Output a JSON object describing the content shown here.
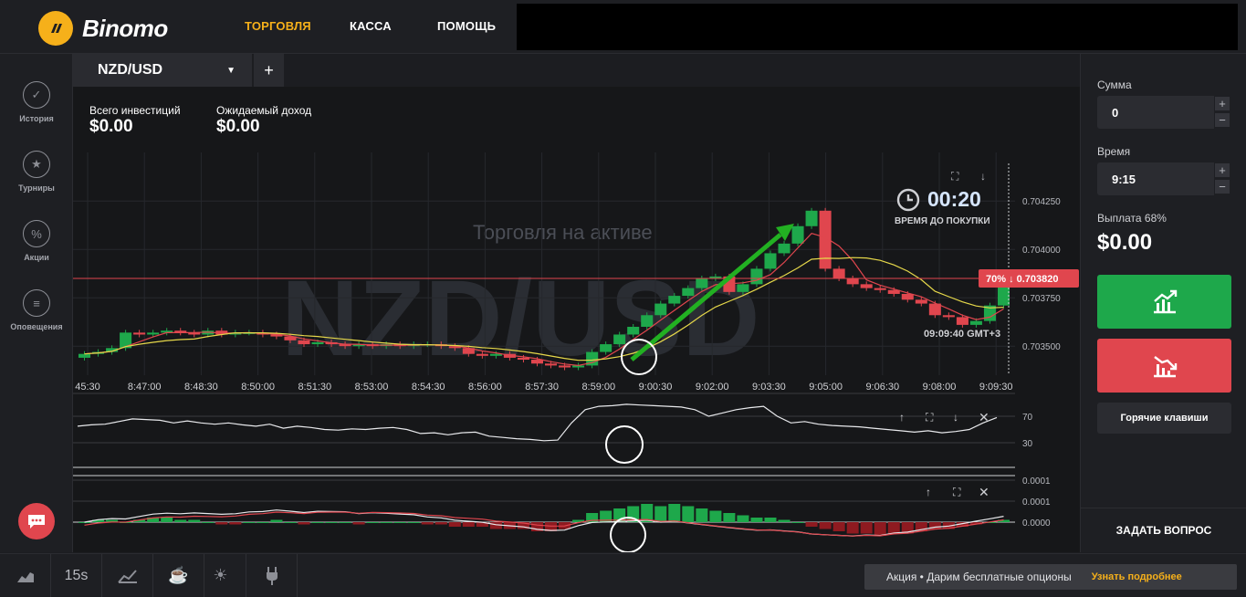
{
  "brand": {
    "name": "Binomo",
    "accent": "#f6b01a"
  },
  "nav": {
    "trade": "ТОРГОВЛЯ",
    "cashier": "КАССА",
    "help": "ПОМОЩЬ"
  },
  "sidebar": {
    "items": [
      {
        "label": "История",
        "icon": "check-circle-icon"
      },
      {
        "label": "Турниры",
        "icon": "trophy-icon"
      },
      {
        "label": "Акции",
        "icon": "percent-icon"
      },
      {
        "label": "Оповещения",
        "icon": "menu-lines-icon"
      }
    ]
  },
  "asset": {
    "name": "NZD/USD",
    "watermark": "NZD/USD",
    "trading_on_asset": "Торговля на активе"
  },
  "stats": {
    "invest_label": "Всего инвестиций",
    "invest_value": "$0.00",
    "expected_label": "Ожидаемый доход",
    "expected_value": "$0.00"
  },
  "timer": {
    "value": "00:20",
    "label": "ВРЕМЯ ДО ПОКУПКИ"
  },
  "price_tag": {
    "percent": "70%",
    "arrow": "↓",
    "price": "0.703820"
  },
  "clock": {
    "text": "09:09:40 GMT+3"
  },
  "chart_data": {
    "type": "candlestick",
    "time_labels": [
      "45:30",
      "8:47:00",
      "8:48:30",
      "8:50:00",
      "8:51:30",
      "8:53:00",
      "8:54:30",
      "8:56:00",
      "8:57:30",
      "8:59:00",
      "9:00:30",
      "9:02:00",
      "9:03:30",
      "9:05:00",
      "9:06:30",
      "9:08:00",
      "9:09:30"
    ],
    "price_ticks": [
      "0.704250",
      "0.704000",
      "0.703750",
      "0.703500"
    ],
    "current_price": 0.70382,
    "oscillator_ticks": [
      "70",
      "30"
    ],
    "macd_ticks": [
      "0.0001",
      "0.0001",
      "0.0000"
    ]
  },
  "right": {
    "amount_label": "Сумма",
    "amount_value": "0",
    "time_label": "Время",
    "time_value": "9:15",
    "payout_label": "Выплата 68%",
    "payout_value": "$0.00",
    "hotkeys": "Горячие клавиши",
    "ask": "ЗАДАТЬ ВОПРОС"
  },
  "bottom": {
    "period": "15s",
    "promo_text": "Акция • Дарим бесплатные опционы",
    "promo_link": "Узнать подробнее"
  },
  "colors": {
    "up": "#1ea84b",
    "down": "#e0464e",
    "bg": "#161719"
  }
}
